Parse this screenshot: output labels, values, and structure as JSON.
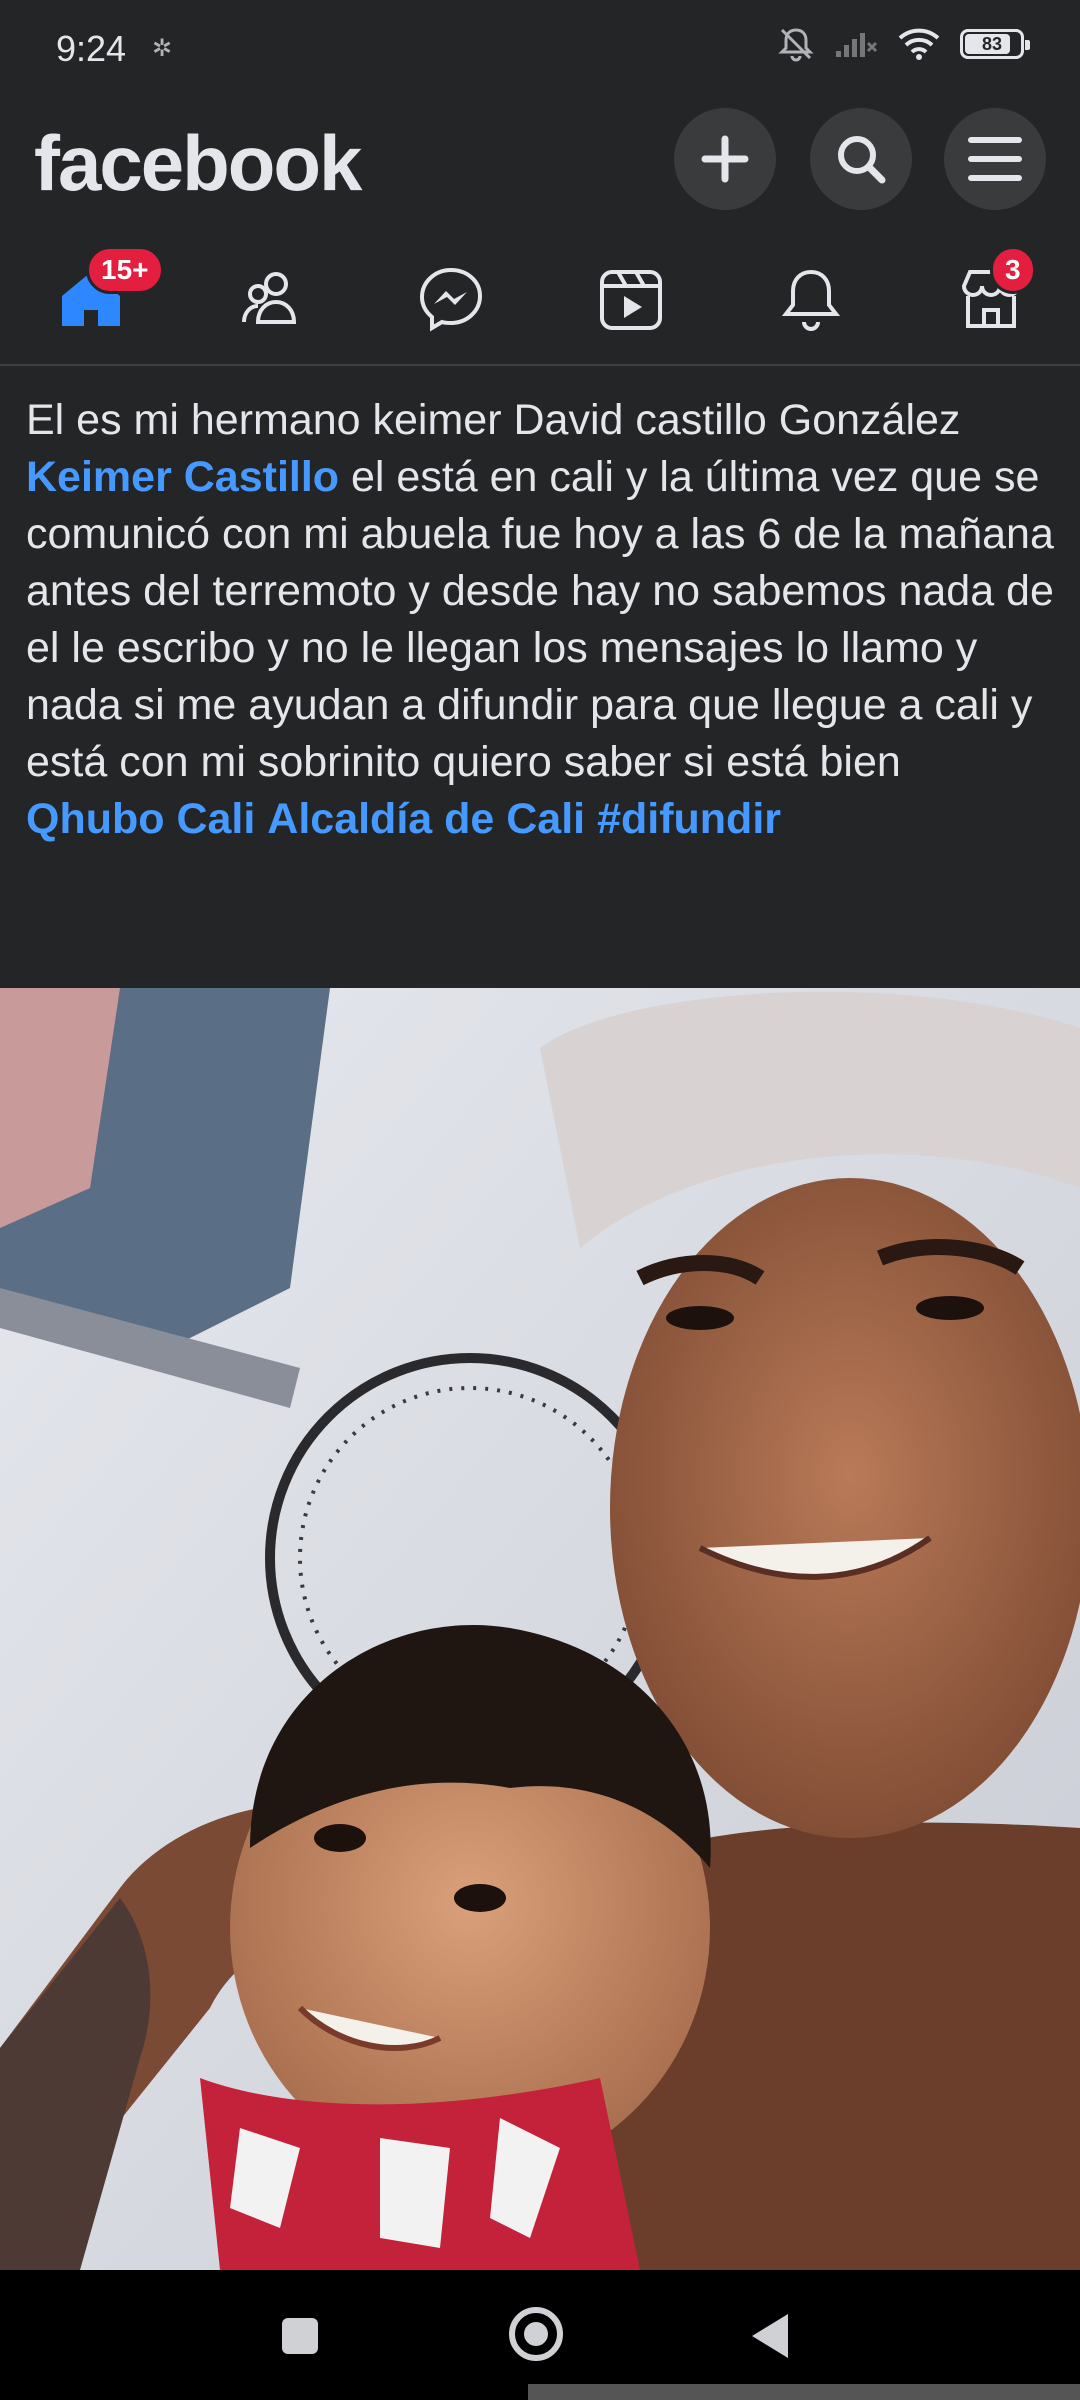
{
  "status_bar": {
    "time": "9:24",
    "battery": "83",
    "battery_level": 0.83,
    "icons": [
      "settings-icon",
      "mute-icon",
      "signal-icon",
      "wifi-icon",
      "battery-icon"
    ]
  },
  "header": {
    "logo": "facebook",
    "buttons": [
      "create-icon",
      "search-icon",
      "menu-icon"
    ]
  },
  "tabs": [
    {
      "name": "home",
      "badge": "15+",
      "active": true
    },
    {
      "name": "friends",
      "badge": ""
    },
    {
      "name": "messenger",
      "badge": ""
    },
    {
      "name": "video",
      "badge": ""
    },
    {
      "name": "notifications",
      "badge": ""
    },
    {
      "name": "marketplace",
      "badge": "3"
    }
  ],
  "post": {
    "line1": "El es mi hermano keimer David castillo González",
    "mention": "Keimer Castillo",
    "body": " el está en cali y la última vez que se comunicó con mi abuela fue hoy a las 6 de la mañana antes del terremoto y desde hay no sabemos nada de el le escribo y no le llegan los mensajes lo llamo y nada si me ayudan a difundir para que llegue a cali y está con mi sobrinito  quiero saber si está bien",
    "tag1": "Qhubo Cali",
    "tag2": "Alcaldía de Cali",
    "hashtag": "#difundir"
  },
  "colors": {
    "background": "#242526",
    "link": "#4599ff",
    "badge": "#e41e3f",
    "active_tab": "#2d88ff"
  }
}
